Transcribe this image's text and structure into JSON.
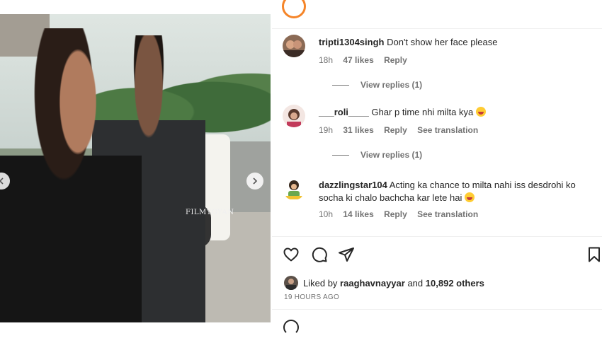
{
  "media": {
    "watermark": "FILMYGYAN"
  },
  "comments": [
    {
      "username": "tripti1304singh",
      "text": "Don't show her face please",
      "time": "18h",
      "likes": "47 likes",
      "reply_label": "Reply",
      "translation_label": "",
      "view_replies": "View replies (1)"
    },
    {
      "username": "___roli____",
      "text": "Ghar p time nhi milta kya",
      "emoji": "laughing-face",
      "time": "19h",
      "likes": "31 likes",
      "reply_label": "Reply",
      "translation_label": "See translation",
      "view_replies": "View replies (1)"
    },
    {
      "username": "dazzlingstar104",
      "text": "Acting ka chance to milta nahi iss desdrohi ko socha ki chalo bachcha kar lete hai",
      "emoji": "laughing-face",
      "time": "10h",
      "likes": "14 likes",
      "reply_label": "Reply",
      "translation_label": "See translation"
    }
  ],
  "actions": {
    "icons": [
      "heart-icon",
      "comment-icon",
      "share-icon",
      "bookmark-icon"
    ]
  },
  "likes_summary": {
    "prefix": "Liked by",
    "user": "raaghavnayyar",
    "joiner": "and",
    "others": "10,892 others"
  },
  "timestamp": "19 HOURS AGO",
  "colors": {
    "text": "#262626",
    "muted": "#737373",
    "divider": "#efefef"
  }
}
